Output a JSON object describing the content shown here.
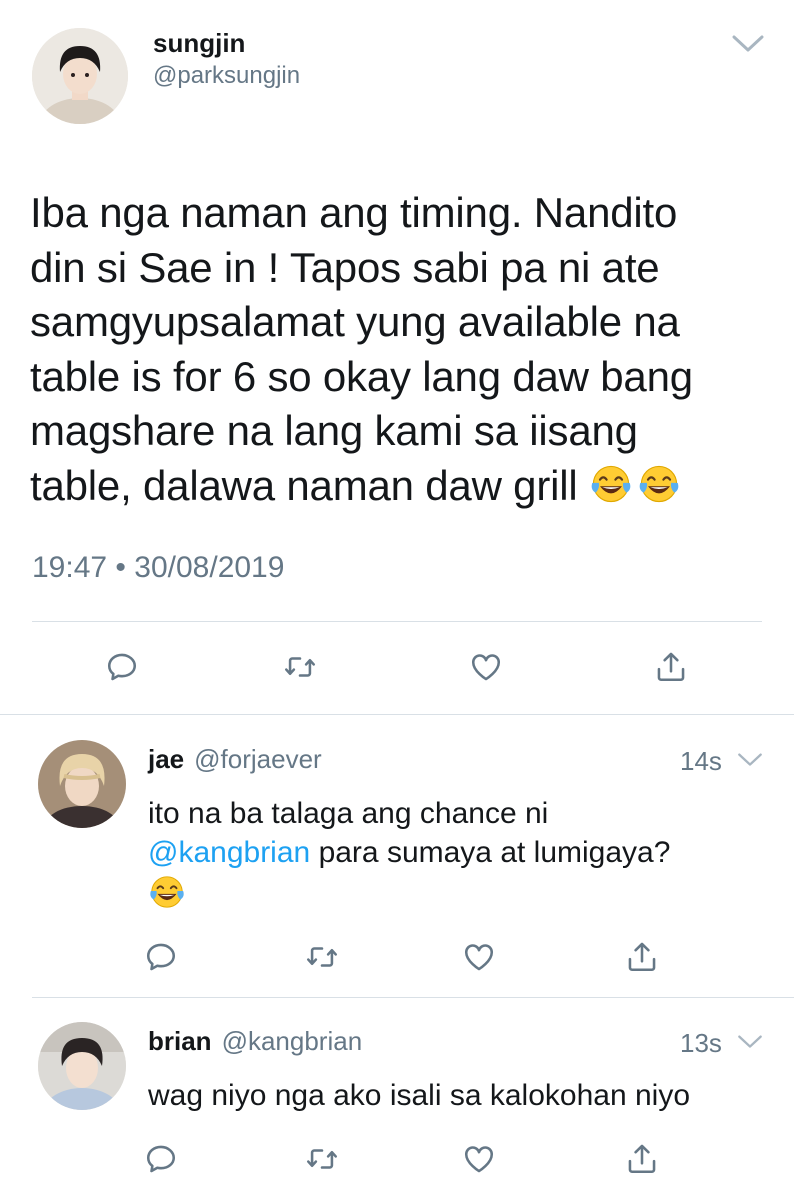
{
  "main_tweet": {
    "name": "sungjin",
    "handle": "@parksungjin",
    "text": "Iba nga naman ang timing. Nandito\ndin si Sae in ! Tapos sabi pa ni ate\nsamgyupsalamat yung available na\ntable is for 6 so okay lang daw bang\nmagshare na lang kami sa iisang\ntable, dalawa naman daw grill",
    "emoji": [
      "face-with-tears-of-joy",
      "face-with-tears-of-joy"
    ],
    "time": "19:47",
    "separator": "•",
    "date": "30/08/2019"
  },
  "replies": [
    {
      "name": "jae",
      "handle": "@forjaever",
      "time": "14s",
      "text_before": "ito na ba talaga ang chance ni",
      "mention": "@kangbrian",
      "text_after": "para sumaya at lumigaya?",
      "emoji": [
        "face-with-tears-of-joy"
      ]
    },
    {
      "name": "brian",
      "handle": "@kangbrian",
      "time": "13s",
      "text": "wag niyo nga ako isali sa kalokohan niyo"
    }
  ],
  "icons": {
    "reply": "reply-icon",
    "retweet": "retweet-icon",
    "like": "like-icon",
    "share": "share-icon",
    "more": "chevron-down-icon"
  },
  "colors": {
    "text": "#14171a",
    "secondary": "#657786",
    "link": "#1da1f2",
    "divider": "#d9e0e6"
  }
}
